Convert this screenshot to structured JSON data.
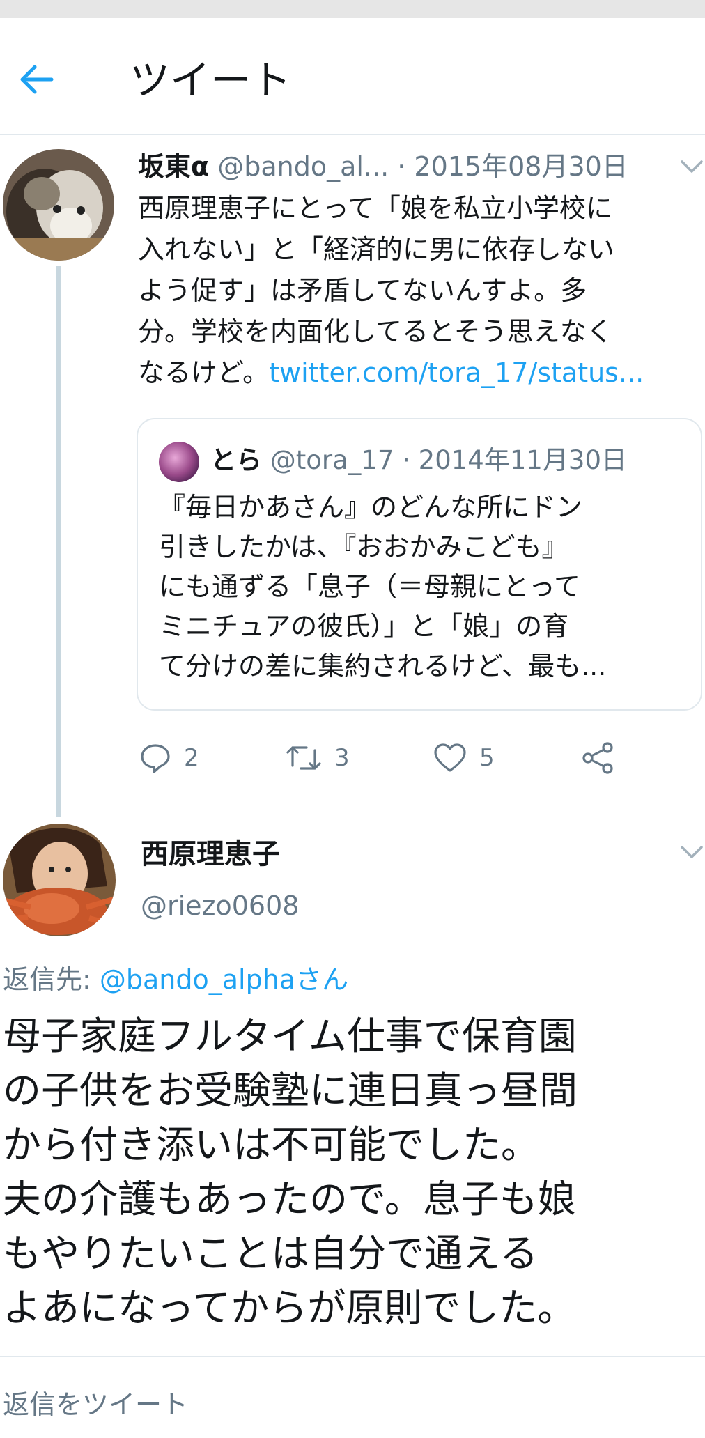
{
  "header": {
    "title": "ツイート"
  },
  "tweet1": {
    "author_name": "坂東α",
    "author_handle": "@bando_al...",
    "date": "· 2015年08月30日",
    "lines": [
      "西原理恵子にとって「娘を私立小学校に",
      "入れない」と「経済的に男に依存しない",
      "よう促す」は矛盾してないんすよ。多",
      "分。学校を内面化してるとそう思えなく"
    ],
    "last_line_text": "なるけど。",
    "link": "twitter.com/tora_17/status...",
    "quote": {
      "author_name": "とら",
      "author_handle": "@tora_17",
      "date": "· 2014年11月30日",
      "lines": [
        "『毎日かあさん』のどんな所にドン",
        "引きしたかは、『おおかみこども』",
        "にも通ずる「息子（＝母親にとって",
        "ミニチュアの彼氏）」と「娘」の育",
        "て分けの差に集約されるけど、最も..."
      ]
    },
    "actions": {
      "replies": "2",
      "retweets": "3",
      "likes": "5"
    }
  },
  "tweet2": {
    "author_name": "西原理恵子",
    "author_handle": "@riezo0608",
    "reply_to_label": "返信先: ",
    "reply_to_handle": "@bando_alphaさん",
    "lines": [
      "母子家庭フルタイム仕事で保育園",
      "の子供をお受験塾に連日真っ昼間",
      "から付き添いは不可能でした。",
      "夫の介護もあったので。息子も娘",
      "もやりたいことは自分で通える",
      "よあになってからが原則でした。"
    ]
  },
  "reply_placeholder": "返信をツイート",
  "colors": {
    "accent": "#1da1f2",
    "muted": "#657786",
    "thread_line": "#c8d7df",
    "border": "#e1e8ed"
  },
  "icons": [
    "back-arrow-icon",
    "chevron-down-icon",
    "reply-icon",
    "retweet-icon",
    "like-icon",
    "share-icon"
  ]
}
